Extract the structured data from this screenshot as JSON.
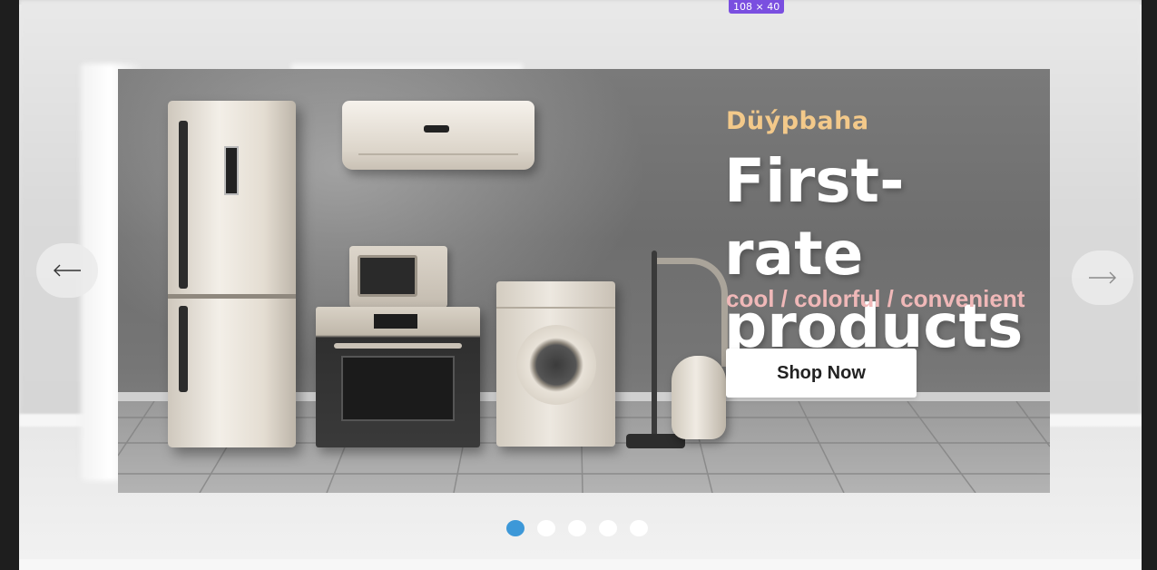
{
  "devtools": {
    "size_tag": "108 × 40"
  },
  "hero": {
    "eyebrow": "Düýpbaha",
    "headline": "First-rate products",
    "tagline": "cool / colorful / convenient",
    "cta_label": "Shop Now"
  },
  "carousel": {
    "prev_icon": "arrow-left-icon",
    "next_icon": "arrow-right-icon",
    "slide_count": 5,
    "active_index": 0
  },
  "colors": {
    "eyebrow": "#f3c98a",
    "tagline": "#f0b8b8",
    "dot_active": "#3d98d8",
    "dot_inactive": "#ffffff",
    "size_tag_bg": "#7a4fe0"
  }
}
